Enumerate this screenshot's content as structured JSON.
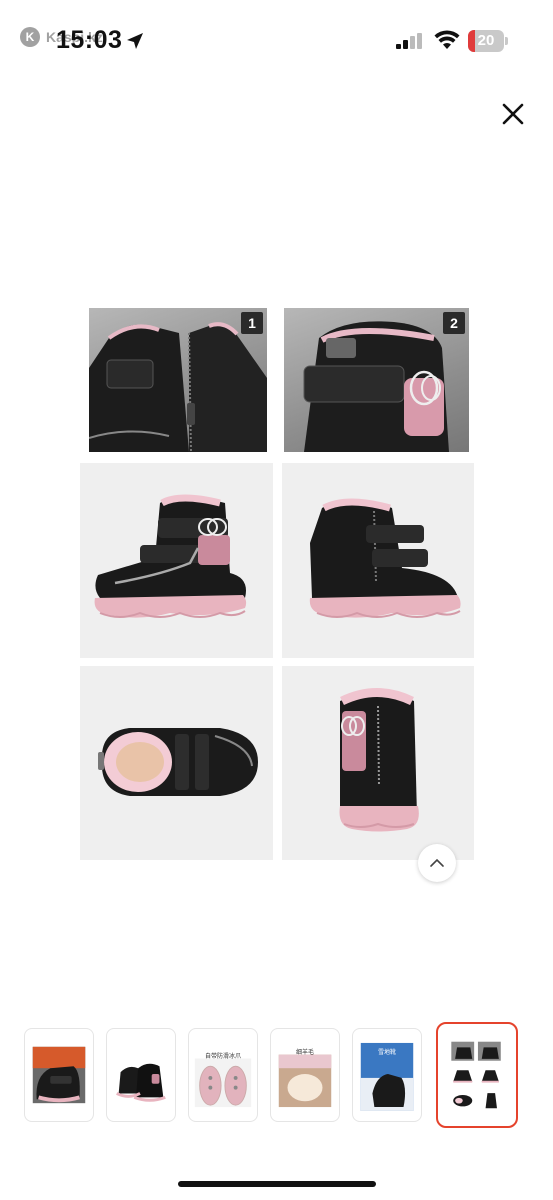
{
  "status_bar": {
    "back_app_label": "Kaspi.kz",
    "back_app_icon": "kaspi-logo-icon",
    "time": "15:03",
    "battery_level": "20",
    "battery_fraction": 0.2,
    "battery_color": "#e03b3b"
  },
  "viewer": {
    "close_icon": "close-icon",
    "scroll_top_icon": "chevron-up-icon",
    "panels": [
      {
        "number": "1"
      },
      {
        "number": "2"
      }
    ]
  },
  "thumbnails": {
    "items": [
      {
        "label": "",
        "selected": false
      },
      {
        "label": "",
        "selected": false
      },
      {
        "label": "自带防滑冰爪",
        "selected": false
      },
      {
        "label": "细羊毛",
        "selected": false
      },
      {
        "label": "雪地靴",
        "selected": false
      },
      {
        "label": "",
        "selected": true
      }
    ],
    "selected_color": "#e5432c"
  }
}
